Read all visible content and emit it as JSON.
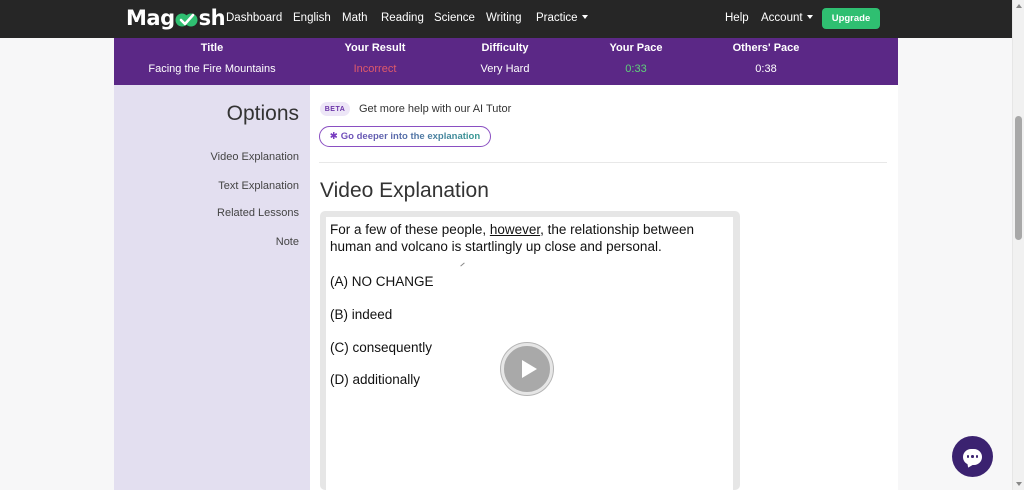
{
  "nav": {
    "logo_text_left": "Mag",
    "logo_text_right": "sh",
    "links": [
      "Dashboard",
      "English",
      "Math",
      "Reading",
      "Science",
      "Writing",
      "Practice"
    ],
    "help": "Help",
    "account": "Account",
    "upgrade": "Upgrade"
  },
  "results": {
    "headers": [
      "Title",
      "Your Result",
      "Difficulty",
      "Your Pace",
      "Others' Pace"
    ],
    "values": [
      "Facing the Fire Mountains",
      "Incorrect",
      "Very Hard",
      "0:33",
      "0:38"
    ],
    "result_color": "#e05a6a",
    "pace_color": "#5fd17a"
  },
  "sidebar": {
    "title": "Options",
    "items": [
      "Video Explanation",
      "Text Explanation",
      "Related Lessons",
      "Note"
    ]
  },
  "main": {
    "beta_badge": "BETA",
    "tutor_text": "Get more help with our AI Tutor",
    "deeper_button": "Go deeper into the explanation",
    "section_title": "Video Explanation"
  },
  "video": {
    "passage_before": "For a few of these people, ",
    "passage_underlined": "however",
    "passage_after": ", the relationship between human and volcano is startlingly up close and personal.",
    "choices": [
      "(A)  NO CHANGE",
      "(B)  indeed",
      "(C)  consequently",
      "(D)  additionally"
    ]
  },
  "colors": {
    "nav_bg": "#262626",
    "results_bg": "#5b2886",
    "sidebar_bg": "#e3dff0",
    "upgrade_bg": "#2fbf71",
    "chat_bg": "#3b2270"
  }
}
